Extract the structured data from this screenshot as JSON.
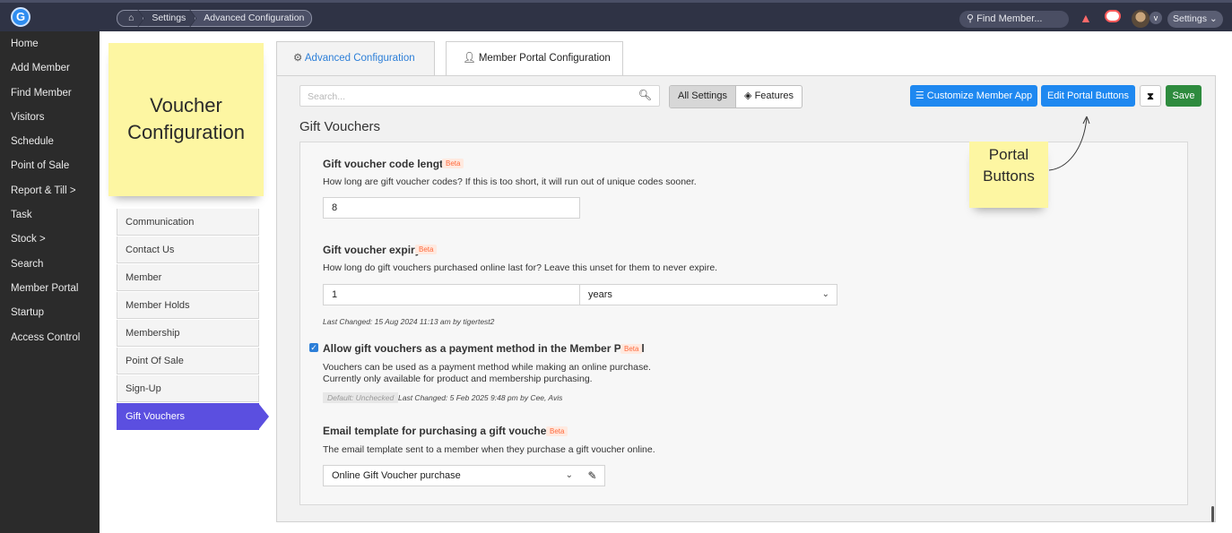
{
  "topbar": {
    "logo_letter": "G",
    "breadcrumbs": [
      "Settings",
      "Advanced Configuration"
    ],
    "find_member_placeholder": "Find Member...",
    "settings_label": "Settings"
  },
  "sidebar": {
    "items": [
      "Home",
      "Add Member",
      "Find Member",
      "Visitors",
      "Schedule",
      "Point of Sale",
      "Report & Till >",
      "Task",
      "Stock >",
      "Search",
      "Member Portal",
      "Startup",
      "Access Control"
    ]
  },
  "subnav": {
    "items": [
      "Communication",
      "Contact Us",
      "Member",
      "Member Holds",
      "Membership",
      "Point Of Sale",
      "Sign-Up",
      "Gift Vouchers"
    ],
    "active": "Gift Vouchers"
  },
  "notes": {
    "voucher_line1": "Voucher",
    "voucher_line2": "Configuration",
    "portal_line1": "Portal",
    "portal_line2": "Buttons"
  },
  "tabs": [
    "Advanced Configuration",
    "Member Portal Configuration"
  ],
  "toolbar": {
    "search_placeholder": "Search...",
    "segments": [
      "All Settings",
      "Features"
    ],
    "customize_label": "Customize Member App",
    "edit_buttons_label": "Edit Portal Buttons",
    "save_label": "Save"
  },
  "section_title": "Gift Vouchers",
  "settings": {
    "code_length": {
      "label": "Gift voucher code length",
      "badge": "Beta",
      "help": "How long are gift voucher codes? If this is too short, it will run out of unique codes sooner.",
      "value": "8"
    },
    "expiry": {
      "label": "Gift voucher expiry",
      "badge": "Beta",
      "help": "How long do gift vouchers purchased online last for? Leave this unset for them to never expire.",
      "value": "1",
      "unit": "years",
      "last_changed": "Last Changed: 15 Aug 2024 11:13 am by tigertest2"
    },
    "allow_payment": {
      "label": "Allow gift vouchers as a payment method in the Member Portal",
      "badge": "Beta",
      "checked": true,
      "help1": "Vouchers can be used as a payment method while making an online purchase.",
      "help2": "Currently only available for product and membership purchasing.",
      "default_chip": "Default: Unchecked",
      "last_changed": "Last Changed: 5 Feb 2025 9:48 pm by Cee, Avis"
    },
    "email_template": {
      "label": "Email template for purchasing a gift voucher",
      "badge": "Beta",
      "help": "The email template sent to a member when they purchase a gift voucher online.",
      "value": "Online Gift Voucher purchase"
    }
  }
}
